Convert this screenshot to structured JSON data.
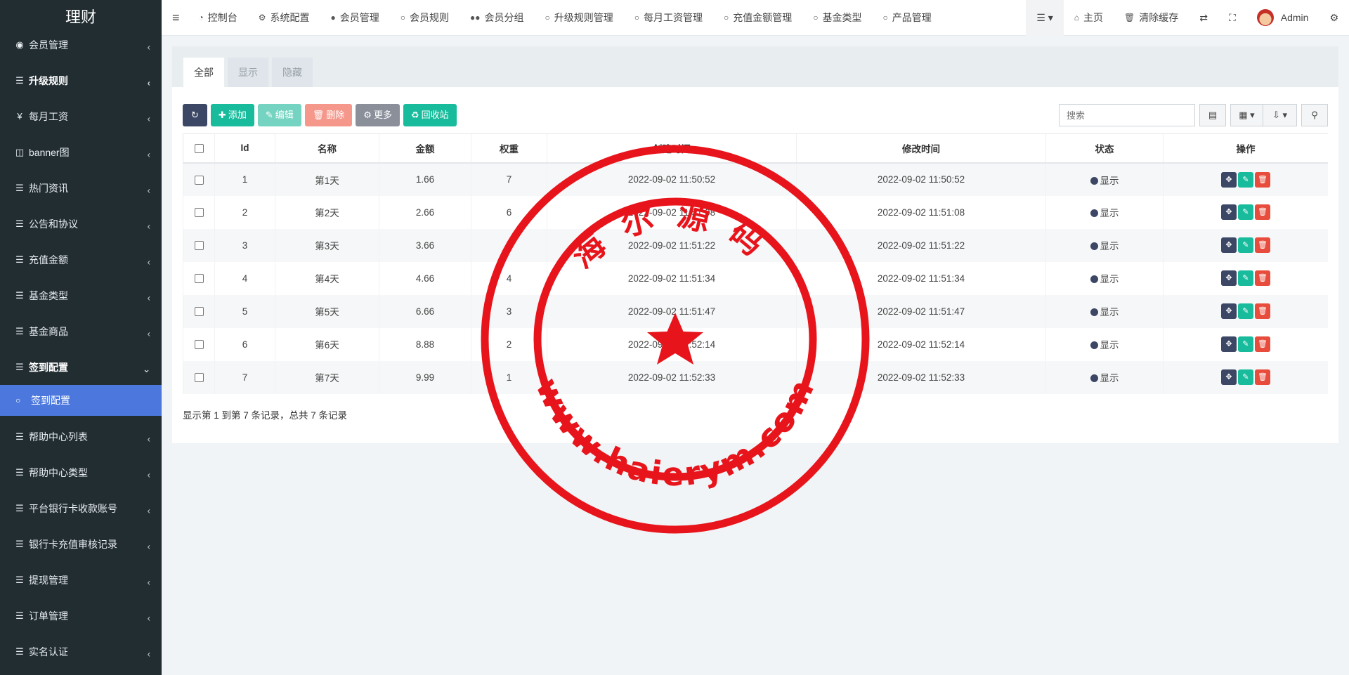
{
  "sidebar": {
    "brand": "理财",
    "items": [
      {
        "label": "会员管理",
        "icon": "user-circle-icon"
      },
      {
        "label": "升级规则",
        "icon": "list-icon"
      },
      {
        "label": "每月工资",
        "icon": "yen-icon"
      },
      {
        "label": "banner图",
        "icon": "columns-icon"
      },
      {
        "label": "热门资讯",
        "icon": "list-icon"
      },
      {
        "label": "公告和协议",
        "icon": "list-icon"
      },
      {
        "label": "充值金额",
        "icon": "list-icon"
      },
      {
        "label": "基金类型",
        "icon": "list-icon"
      },
      {
        "label": "基金商品",
        "icon": "list-icon"
      },
      {
        "label": "签到配置",
        "icon": "list-icon"
      }
    ],
    "active_sub": "签到配置",
    "items_after": [
      {
        "label": "帮助中心列表",
        "icon": "list-icon"
      },
      {
        "label": "帮助中心类型",
        "icon": "list-icon"
      },
      {
        "label": "平台银行卡收款账号",
        "icon": "list-icon"
      },
      {
        "label": "银行卡充值审核记录",
        "icon": "list-icon"
      },
      {
        "label": "提现管理",
        "icon": "list-icon"
      },
      {
        "label": "订单管理",
        "icon": "list-icon"
      },
      {
        "label": "实名认证",
        "icon": "list-icon"
      }
    ]
  },
  "topbar": {
    "tabs": [
      "控制台",
      "系统配置",
      "会员管理",
      "会员规则",
      "会员分组",
      "升级规则管理",
      "每月工资管理",
      "充值金额管理",
      "基金类型",
      "产品管理"
    ],
    "home": "主页",
    "clear_cache": "清除缓存",
    "user": "Admin"
  },
  "content": {
    "tabs": [
      "全部",
      "显示",
      "隐藏"
    ],
    "active_tab": "全部",
    "toolbar": {
      "add": "添加",
      "edit": "编辑",
      "delete": "删除",
      "more": "更多",
      "recycle": "回收站"
    },
    "search": {
      "placeholder": "搜索"
    },
    "table": {
      "columns": [
        "Id",
        "名称",
        "金额",
        "权重",
        "创建时间",
        "修改时间",
        "状态",
        "操作"
      ],
      "rows": [
        {
          "id": "1",
          "name": "第1天",
          "amount": "1.66",
          "weight": "7",
          "created": "2022-09-02 11:50:52",
          "updated": "2022-09-02 11:50:52",
          "status": "显示"
        },
        {
          "id": "2",
          "name": "第2天",
          "amount": "2.66",
          "weight": "6",
          "created": "2022-09-02 11:51:08",
          "updated": "2022-09-02 11:51:08",
          "status": "显示"
        },
        {
          "id": "3",
          "name": "第3天",
          "amount": "3.66",
          "weight": "5",
          "created": "2022-09-02 11:51:22",
          "updated": "2022-09-02 11:51:22",
          "status": "显示"
        },
        {
          "id": "4",
          "name": "第4天",
          "amount": "4.66",
          "weight": "4",
          "created": "2022-09-02 11:51:34",
          "updated": "2022-09-02 11:51:34",
          "status": "显示"
        },
        {
          "id": "5",
          "name": "第5天",
          "amount": "6.66",
          "weight": "3",
          "created": "2022-09-02 11:51:47",
          "updated": "2022-09-02 11:51:47",
          "status": "显示"
        },
        {
          "id": "6",
          "name": "第6天",
          "amount": "8.88",
          "weight": "2",
          "created": "2022-09-02 11:52:14",
          "updated": "2022-09-02 11:52:14",
          "status": "显示"
        },
        {
          "id": "7",
          "name": "第7天",
          "amount": "9.99",
          "weight": "1",
          "created": "2022-09-02 11:52:33",
          "updated": "2022-09-02 11:52:33",
          "status": "显示"
        }
      ]
    },
    "page_info": "显示第 1 到第 7 条记录，总共 7 条记录"
  },
  "watermark": {
    "top_text": "海尔源码",
    "bottom_text": "www.haierym.com",
    "color": "#e8141b"
  },
  "colors": {
    "sidebar_bg": "#222d32",
    "sidebar_active": "#4c78dd",
    "primary_dark": "#3b4764",
    "success": "#18bc9c",
    "danger": "#e74c3c"
  }
}
